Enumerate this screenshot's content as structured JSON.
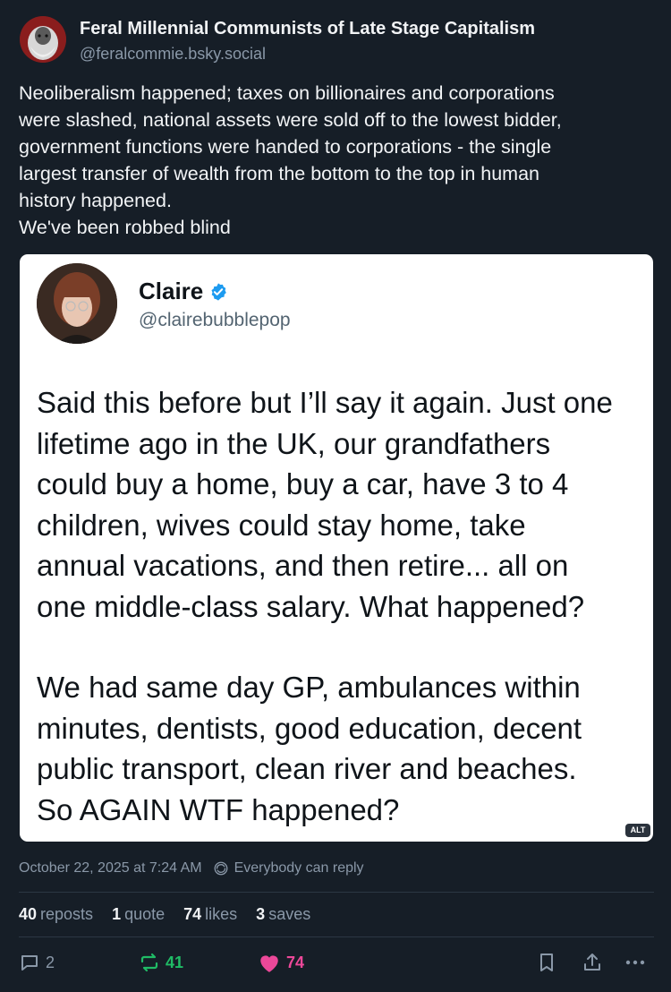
{
  "post": {
    "author_name": "Feral Millennial Communists of Late Stage Capitalism",
    "author_handle": "@feralcommie.bsky.social",
    "text_lines": [
      "Neoliberalism happened; taxes on billionaires and corporations",
      "were slashed, national assets were sold off to the lowest bidder,",
      "government functions were handed to corporations - the single",
      "largest transfer of wealth from the bottom to the top in human",
      "history happened.",
      "We've been robbed blind"
    ],
    "timestamp": "October 22, 2025 at 7:24 AM",
    "reply_setting": "Everybody can reply",
    "icons": {
      "avatar": "avatar-portrait",
      "reply_setting": "globe-reply-icon"
    }
  },
  "embed": {
    "name": "Claire",
    "handle": "@clairebubblepop",
    "verified_icon": "verified-badge-icon",
    "text_lines_p1": [
      "Said this before but I’ll say it again. Just one",
      "lifetime ago in the UK, our grandfathers",
      "could buy a home, buy a car, have 3 to 4",
      "children, wives could stay home, take",
      "annual vacations, and then retire... all on",
      "one middle-class salary. What happened?"
    ],
    "text_lines_p2": [
      "We had same day GP, ambulances within",
      "minutes, dentists, good education, decent",
      "public transport, clean river and beaches.",
      "So AGAIN WTF happened?"
    ],
    "alt_badge": "ALT"
  },
  "stats": {
    "reposts_count": "40",
    "reposts_label": "reposts",
    "quotes_count": "1",
    "quotes_label": "quote",
    "likes_count": "74",
    "likes_label": "likes",
    "saves_count": "3",
    "saves_label": "saves"
  },
  "actions": {
    "reply_count": "2",
    "repost_count": "41",
    "like_count": "74",
    "icons": [
      "reply-icon",
      "repost-icon",
      "heart-icon",
      "bookmark-icon",
      "share-icon",
      "more-icon"
    ]
  },
  "colors": {
    "background": "#161e27",
    "repost_active": "#20bc66",
    "like_active": "#ec4899",
    "verified": "#1d9bf0"
  }
}
